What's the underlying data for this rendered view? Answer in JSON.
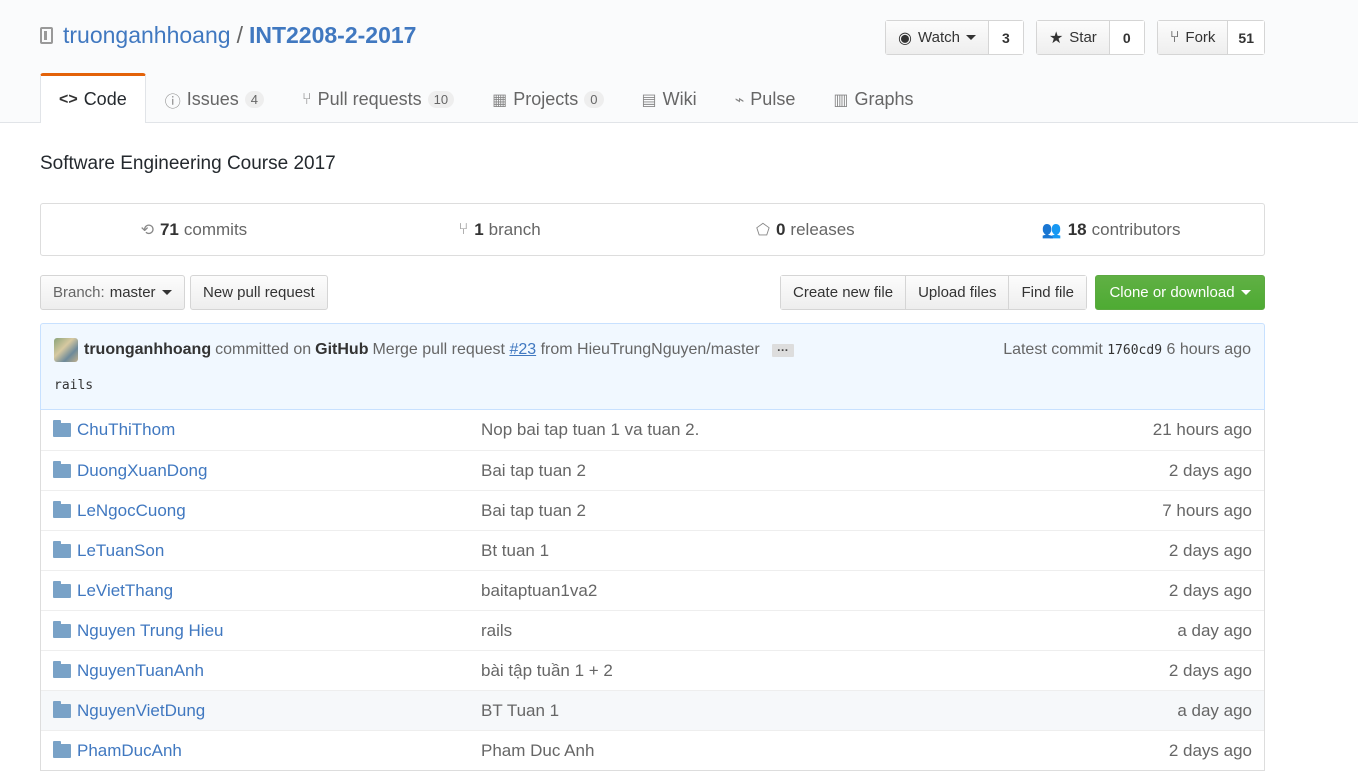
{
  "repo": {
    "owner": "truonganhhoang",
    "separator": "/",
    "name": "INT2208-2-2017",
    "description": "Software Engineering Course 2017"
  },
  "actions": {
    "watch_label": "Watch",
    "watch_count": "3",
    "star_label": "Star",
    "star_count": "0",
    "fork_label": "Fork",
    "fork_count": "51"
  },
  "tabs": [
    {
      "label": "Code",
      "icon": "code-icon",
      "glyph": "<>"
    },
    {
      "label": "Issues",
      "icon": "issue-icon",
      "glyph": "ⓘ",
      "counter": "4"
    },
    {
      "label": "Pull requests",
      "icon": "pull-request-icon",
      "glyph": "⑂",
      "counter": "10"
    },
    {
      "label": "Projects",
      "icon": "project-icon",
      "glyph": "▦",
      "counter": "0"
    },
    {
      "label": "Wiki",
      "icon": "book-icon",
      "glyph": "▤"
    },
    {
      "label": "Pulse",
      "icon": "pulse-icon",
      "glyph": "⌁"
    },
    {
      "label": "Graphs",
      "icon": "graph-icon",
      "glyph": "▥"
    }
  ],
  "summary": {
    "commits_count": "71",
    "commits_label": "commits",
    "branch_count": "1",
    "branch_label": "branch",
    "releases_count": "0",
    "releases_label": "releases",
    "contributors_count": "18",
    "contributors_label": "contributors"
  },
  "filebar": {
    "branch_prefix": "Branch:",
    "branch_name": "master",
    "new_pr": "New pull request",
    "create_file": "Create new file",
    "upload_files": "Upload files",
    "find_file": "Find file",
    "clone": "Clone or download",
    "clone_color": "#60b044"
  },
  "commit": {
    "author": "truonganhhoang",
    "committed_on": "committed on",
    "committer": "GitHub",
    "message_prefix": "Merge pull request",
    "pr_link": "#23",
    "message_suffix": "from HieuTrungNguyen/master",
    "ellipsis": "…",
    "latest_label": "Latest commit",
    "sha": "1760cd9",
    "age": "6 hours ago",
    "description": "rails"
  },
  "files": [
    {
      "name": "ChuThiThom",
      "message": "Nop bai tap tuan 1 va tuan 2.",
      "age": "21 hours ago"
    },
    {
      "name": "DuongXuanDong",
      "message": "Bai tap tuan 2",
      "age": "2 days ago"
    },
    {
      "name": "LeNgocCuong",
      "message": "Bai tap tuan 2",
      "age": "7 hours ago"
    },
    {
      "name": "LeTuanSon",
      "message": "Bt tuan 1",
      "age": "2 days ago"
    },
    {
      "name": "LeVietThang",
      "message": "baitaptuan1va2",
      "age": "2 days ago"
    },
    {
      "name": "Nguyen Trung Hieu",
      "message": "rails",
      "age": "a day ago"
    },
    {
      "name": "NguyenTuanAnh",
      "message": "bài tập tuần 1 + 2",
      "age": "2 days ago"
    },
    {
      "name": "NguyenVietDung",
      "message": "BT Tuan 1",
      "age": "a day ago"
    },
    {
      "name": "PhamDucAnh",
      "message": "Pham Duc Anh",
      "age": "2 days ago"
    }
  ]
}
